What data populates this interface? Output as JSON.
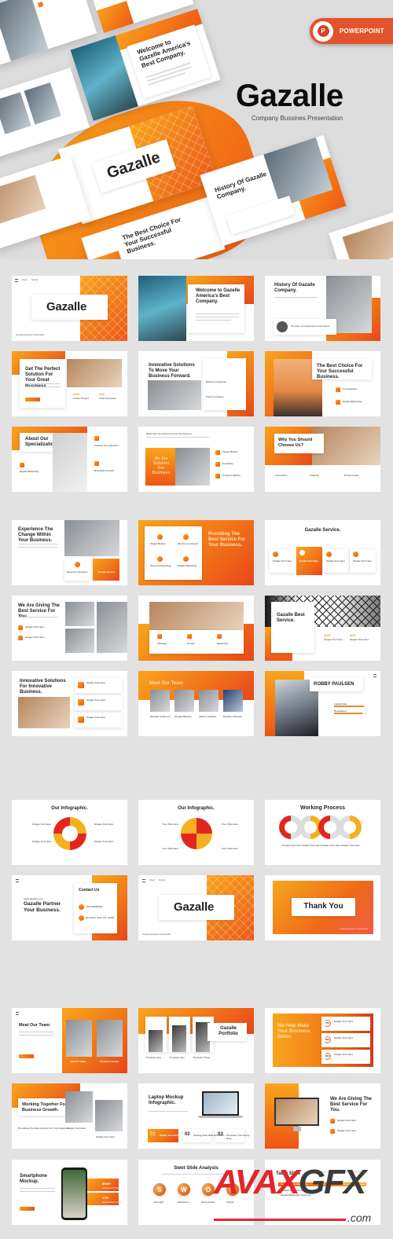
{
  "hero": {
    "title": "Gazalle",
    "subtitle": "Company Bussines Presentation",
    "badge_label": "POWERPOINT",
    "badge_icon": "powerpoint-icon",
    "badge_icon_letter": "P",
    "preview_titles": {
      "welcome": "Welcome to Gazelle America's Best Company.",
      "cover": "Gazalle",
      "history": "History Of Gazalle Company.",
      "best_choice": "The Best Choice For Your Successful Business."
    }
  },
  "colors": {
    "accent_orange": "#f07018",
    "accent_yellow": "#f9a51b",
    "accent_red": "#e8461a",
    "background": "#e2e2e2",
    "badge": "#e3532d"
  },
  "slides": {
    "r1": {
      "cover": {
        "title": "Gazalle",
        "nav": [
          "About",
          "Service"
        ],
        "footer": "Company Bussines Presentation"
      },
      "welcome": {
        "title": "Welcome to Gazelle America's Best Company."
      },
      "history": {
        "title": "History Of Gazalle Company.",
        "card_label": "15 years of experience in business"
      }
    },
    "r2": {
      "perfect": {
        "title": "Get The Perfect Solution For Your Great Business.",
        "stat1": "200+",
        "stat2": "20K",
        "stat1_label": "Active Project",
        "stat2_label": "Total Customer"
      },
      "innovative": {
        "title": "Innovative Solutions To Move Your Business Forward.",
        "sub1": "Modern Company",
        "sub2": "Fresh Company"
      },
      "best_choice": {
        "title": "The Best Choice For Your Successful Business.",
        "item1": "Consultation",
        "item2": "Digital Marketing"
      }
    },
    "r3": {
      "about": {
        "title": "About Our Specialization.",
        "item1": "Finance Consultation",
        "item2": "Digital Marketing",
        "item3": "Branding Product"
      },
      "solution": {
        "header": "We Provide The Solution To Grow Your Business",
        "overlay": "We Are Solution Our Business",
        "item1": "Target Market",
        "item2": "Creativity",
        "item3": "Analysis Market"
      },
      "why": {
        "title": "Why You Should Choose Us?",
        "col1": "Innovation",
        "col2": "Integrity",
        "col3": "Professional"
      }
    },
    "r4": {
      "experience": {
        "title": "Experience The Change Within Your Business.",
        "card1": "Research Analysis",
        "card2": "Simple Service"
      },
      "providing": {
        "title": "Providing The Best Service For Your Business.",
        "item1": "Target Market",
        "item2": "Business Analysis",
        "item3": "Personal Branding",
        "item4": "Digital Marketing"
      },
      "service": {
        "title": "Gazalle Service.",
        "items": [
          "Simple Text Here",
          "Simple Text Here",
          "Simple Text Here",
          "Simple Text Here"
        ]
      }
    },
    "r5": {
      "giving": {
        "title": "We Are Giving The Best Service For You.",
        "item1": "Simple Text Here",
        "item2": "Simple Text Here"
      },
      "team_photo": {
        "item1": "Strategy",
        "item2": "Design",
        "item3": "Marketing"
      },
      "best_service": {
        "title": "Gazalle Best Service.",
        "stat1": "200+",
        "stat2": "90%",
        "stat1_label": "Simple Text Here",
        "stat2_label": "Simple Text Here"
      }
    },
    "r6": {
      "innovative2": {
        "title": "Innovative Solutions For Innovative Business.",
        "items": [
          "Simple Text Here",
          "Simple Text Here",
          "Simple Text Here"
        ]
      },
      "team": {
        "title": "Meet Our Team",
        "members": [
          "Michale Anderson",
          "Angela Martina",
          "Jeffry F. Wellah",
          "Robby's Paulsen"
        ]
      },
      "profile": {
        "name": "ROBBY PAULSEN",
        "skill1": "Leadership",
        "skill2": "Reputation",
        "skill1_value": 90,
        "skill2_value": 85
      }
    },
    "r7": {
      "infographic1": {
        "title": "Our Infographic.",
        "labels": [
          "Simple Text Here",
          "Simple Text Here",
          "Simple Text Here",
          "Simple Text Here"
        ]
      },
      "infographic2": {
        "title": "Our Infographic.",
        "labels": [
          "Your Title Here",
          "Your Title Here",
          "Your Title Here",
          "Your Title Here"
        ]
      },
      "process": {
        "title": "Working Process",
        "labels": [
          "Simple Text Here",
          "Simple Text Here",
          "Simple Text Here",
          "Simple Text Here"
        ]
      }
    },
    "r8": {
      "contact": {
        "kicker": "www.gazalle.com",
        "title": "Gazalle Partner Your Business.",
        "card_title": "Contact Us",
        "address": "+62 123456789",
        "location": "Brooklyn Utan, US, 10060"
      },
      "cover2": {
        "title": "Gazalle",
        "nav": [
          "About",
          "Service"
        ],
        "footer": "Company Bussines Presentation"
      },
      "thankyou": {
        "title": "Thank You",
        "footer": "Company Bussines Presentation"
      }
    },
    "r9": {
      "meat_team": {
        "title": "Meat Our Team",
        "members": [
          "Isabella Smith",
          "Frederick Gustav"
        ],
        "button": "Read More"
      },
      "portfolio": {
        "title": "Gazalle Portfolio",
        "items": [
          "Portfolio One",
          "Portfolio Two",
          "Portfolio Three"
        ]
      },
      "help": {
        "title": "We Help Make Your Business Better.",
        "items": [
          {
            "label": "Simple Text Here",
            "value": "70%"
          },
          {
            "label": "Simple Text Here",
            "value": "80%"
          },
          {
            "label": "Simple Text Here",
            "value": "90%"
          }
        ]
      }
    },
    "r10": {
      "together": {
        "title": "Working Together For Business Growth.",
        "sub": "Providing The Best Service For Your Business",
        "item1": "Simple Text Here",
        "item2": "Simple Text Here"
      },
      "laptop": {
        "title": "Laptop Mockup Infographic.",
        "steps": [
          {
            "num": "01",
            "label": "Simple Text Here"
          },
          {
            "num": "02",
            "label": "Getting Start With Business"
          },
          {
            "num": "03",
            "label": "Generate Your Every Step"
          }
        ]
      },
      "giving2": {
        "title": "We Are Giving The Best Service For You.",
        "item1": "Simple Text Here",
        "item2": "Simple Text Here"
      }
    },
    "r11": {
      "smartphone": {
        "title": "Smartphone Mockup.",
        "stat1": "3050+",
        "stat2": "175+",
        "stat1_label": "Customer Project",
        "stat2_label": "Application Project",
        "button": "Read More"
      },
      "swot": {
        "title": "Swot Slide Analysis",
        "letters": [
          "S",
          "W",
          "O",
          "T"
        ],
        "labels": [
          "Strength",
          "Weakness",
          "Opportunity",
          "Threat"
        ]
      },
      "table": {
        "title": "Table Slide",
        "header": [
          "Customer Detail Card Details",
          "Basic",
          "Standard",
          "Professional",
          "Premium"
        ],
        "rows": [
          "Unlimited Access For Two User",
          "Global Marketing Tool User"
        ]
      }
    }
  },
  "watermark": {
    "brand_red": "AVAX",
    "brand_gray": "GFX",
    "domain": ".com"
  }
}
